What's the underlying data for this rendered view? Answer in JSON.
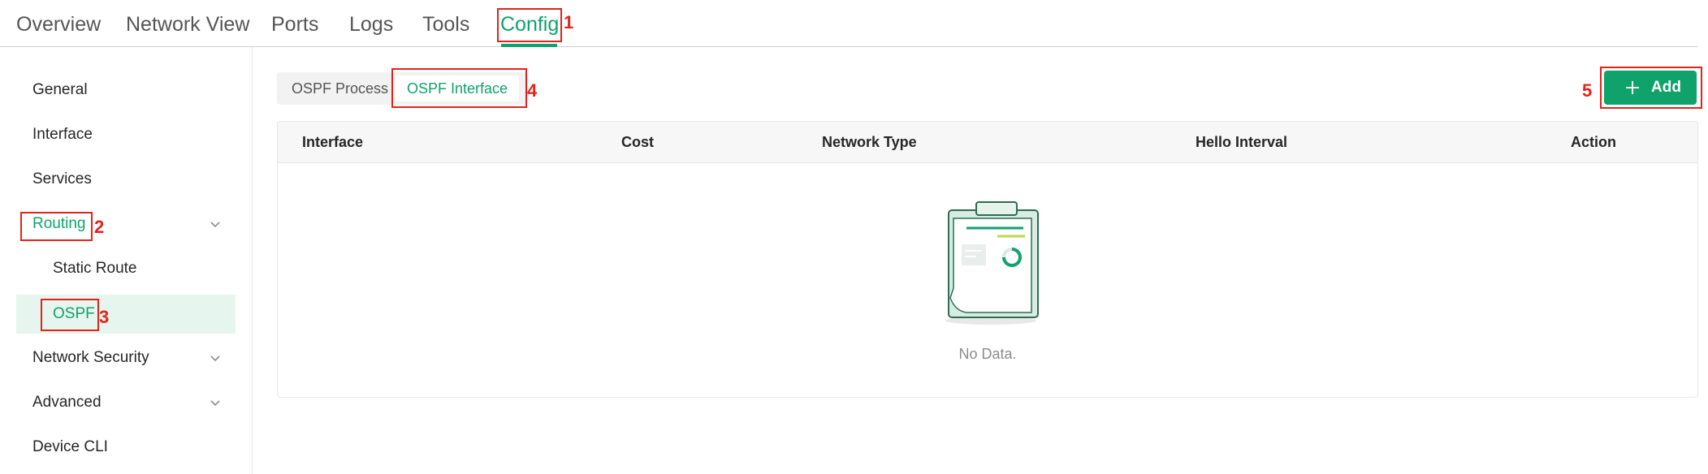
{
  "top_tabs": [
    "Overview",
    "Network View",
    "Ports",
    "Logs",
    "Tools",
    "Config"
  ],
  "active_top_tab": "Config",
  "sidebar": {
    "items": [
      {
        "label": "General"
      },
      {
        "label": "Interface"
      },
      {
        "label": "Services"
      },
      {
        "label": "Routing",
        "expandable": true,
        "expanded": true
      },
      {
        "label": "Static Route"
      },
      {
        "label": "OSPF",
        "selected": true
      },
      {
        "label": "Network Security",
        "expandable": true
      },
      {
        "label": "Advanced",
        "expandable": true
      },
      {
        "label": "Device CLI"
      }
    ]
  },
  "subtabs": [
    "OSPF Process",
    "OSPF Interface"
  ],
  "active_subtab": "OSPF Interface",
  "add_button": {
    "label": "Add",
    "icon": "plus-icon"
  },
  "table": {
    "columns": [
      "Interface",
      "Cost",
      "Network Type",
      "Hello Interval",
      "Action"
    ],
    "rows": [],
    "empty_text": "No Data.",
    "empty_icon": "clipboard-icon"
  },
  "annotations": [
    "1",
    "2",
    "3",
    "4",
    "5"
  ],
  "colors": {
    "accent": "#0fa36b",
    "annotation": "#e0241b",
    "selected_bg": "#e6f5ee"
  }
}
